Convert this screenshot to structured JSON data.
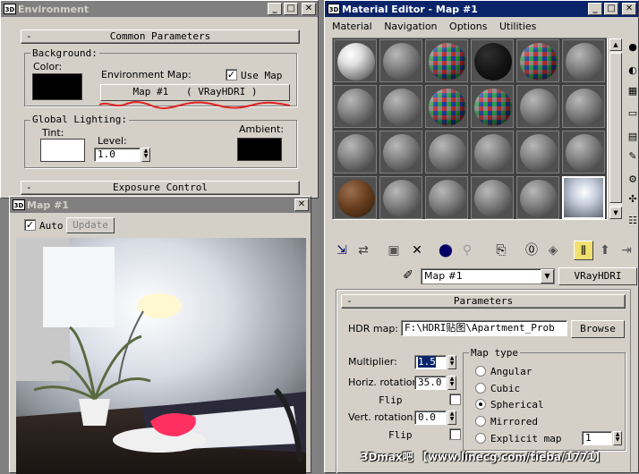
{
  "environment": {
    "title": "Environment",
    "common_params": "Common Parameters",
    "background_label": "Background:",
    "color_label": "Color:",
    "color_value": "#000000",
    "env_map_label": "Environment Map:",
    "use_map_label": "Use Map",
    "use_map_checked": "✓",
    "map_button": "Map #1   ( VRayHDRI )",
    "global_lighting": "Global Lighting:",
    "tint_label": "Tint:",
    "tint_color": "#ffffff",
    "level_label": "Level:",
    "level_value": "1.0",
    "ambient_label": "Ambient:",
    "ambient_color": "#000000",
    "exposure_control": "Exposure Control"
  },
  "map_preview": {
    "title": "Map #1",
    "auto_label": "Auto",
    "auto_checked": "✓",
    "update_label": "Update"
  },
  "material_editor": {
    "title": "Material Editor - Map #1",
    "menu": [
      "Material",
      "Navigation",
      "Options",
      "Utilities"
    ],
    "slots": [
      "white-sphere",
      "gray-sphere",
      "hdri-sphere",
      "black-sphere",
      "hdri-sphere",
      "gray-sphere",
      "gray-sphere",
      "gray-sphere",
      "hdri-sphere",
      "hdri-sphere",
      "gray-sphere",
      "gray-sphere",
      "gray-sphere",
      "gray-sphere",
      "gray-sphere",
      "gray-sphere",
      "gray-sphere",
      "gray-sphere",
      "wood-sphere",
      "gray-sphere",
      "gray-sphere",
      "gray-sphere",
      "gray-sphere",
      "hdri-env"
    ],
    "map_name": "Map #1",
    "map_type_button": "VRayHDRI",
    "parameters_head": "Parameters",
    "hdr_map_label": "HDR map:",
    "hdr_map_path": "F:\\HDRI贴图\\Apartment_Prob",
    "browse_label": "Browse",
    "multiplier_label": "Multiplier:",
    "multiplier_value": "1.5",
    "horiz_rotation_label": "Horiz. rotation:",
    "horiz_rotation_value": "35.0",
    "flip1_label": "Flip",
    "vert_rotation_label": "Vert. rotation:",
    "vert_rotation_value": "0.0",
    "flip2_label": "Flip",
    "map_type_label": "Map type",
    "map_types": [
      "Angular",
      "Cubic",
      "Spherical",
      "Mirrored",
      "Explicit map"
    ],
    "selected_map_type": "Spherical",
    "explicit_channel": "1"
  },
  "watermark": "3Dmax吧 【www.linecg.com/tieba/1771】",
  "colors": {
    "titlebar_active": "#0a246a",
    "titlebar_inactive": "#808080",
    "face": "#d4d0c8",
    "annotation_red": "#e02020"
  }
}
